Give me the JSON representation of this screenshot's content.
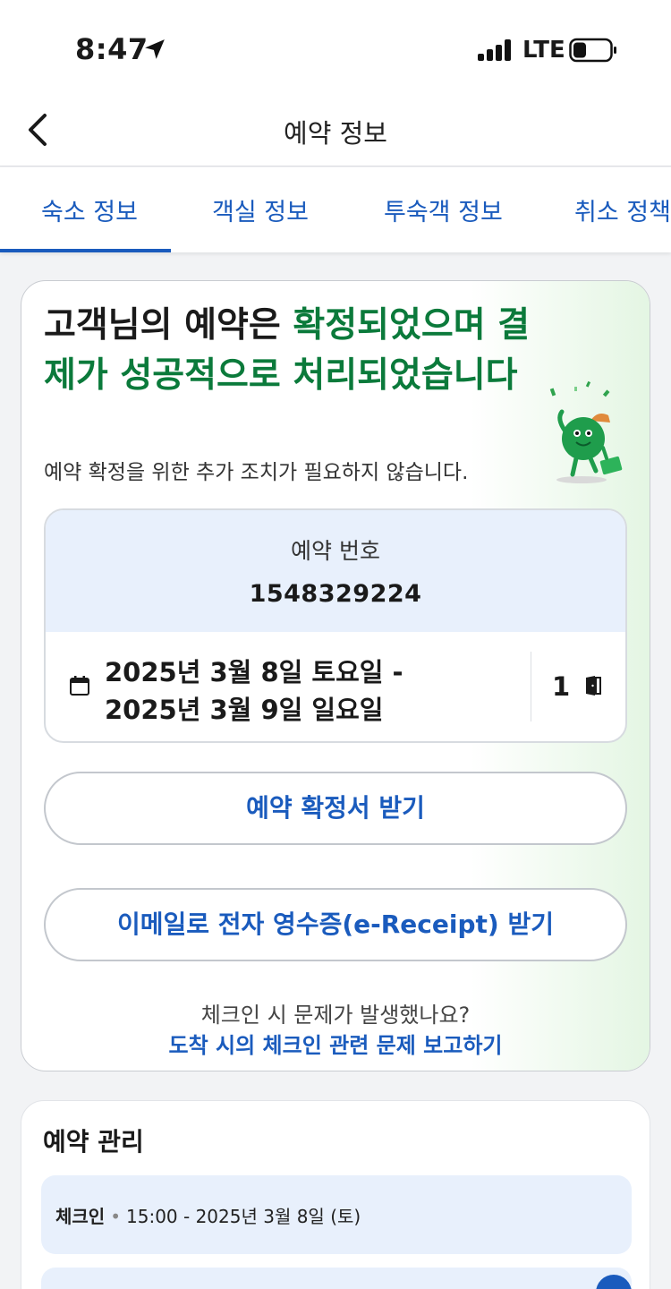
{
  "status_bar": {
    "time": "8:47",
    "network": "LTE"
  },
  "header": {
    "title": "예약 정보"
  },
  "tabs": [
    {
      "label": "숙소 정보"
    },
    {
      "label": "객실 정보"
    },
    {
      "label": "투숙객 정보"
    },
    {
      "label": "취소 정책"
    }
  ],
  "confirmation": {
    "title_plain": "고객님의 예약은 ",
    "title_green": "확정되었으며 결제가 성공적으로 처리되었습니다",
    "subtitle": "예약 확정을 위한 추가 조치가 필요하지 않습니다.",
    "booking_label": "예약 번호",
    "booking_number": "1548329224",
    "date_line1": "2025년 3월 8일 토요일 -",
    "date_line2": "2025년 3월 9일 일요일",
    "room_count": "1",
    "confirm_button": "예약 확정서 받기",
    "receipt_button": "이메일로 전자 영수증(e-Receipt) 받기",
    "checkin_question": "체크인 시 문제가 발생했나요?",
    "checkin_link": "도착 시의 체크인 관련 문제 보고하기"
  },
  "manage": {
    "title": "예약 관리",
    "checkin_label": "체크인",
    "checkin_detail": "15:00 - 2025년 3월 8일 (토)"
  },
  "colors": {
    "accent_blue": "#1a5bbd",
    "success_green": "#0b7a3b",
    "panel_blue": "#e8f0fc"
  }
}
